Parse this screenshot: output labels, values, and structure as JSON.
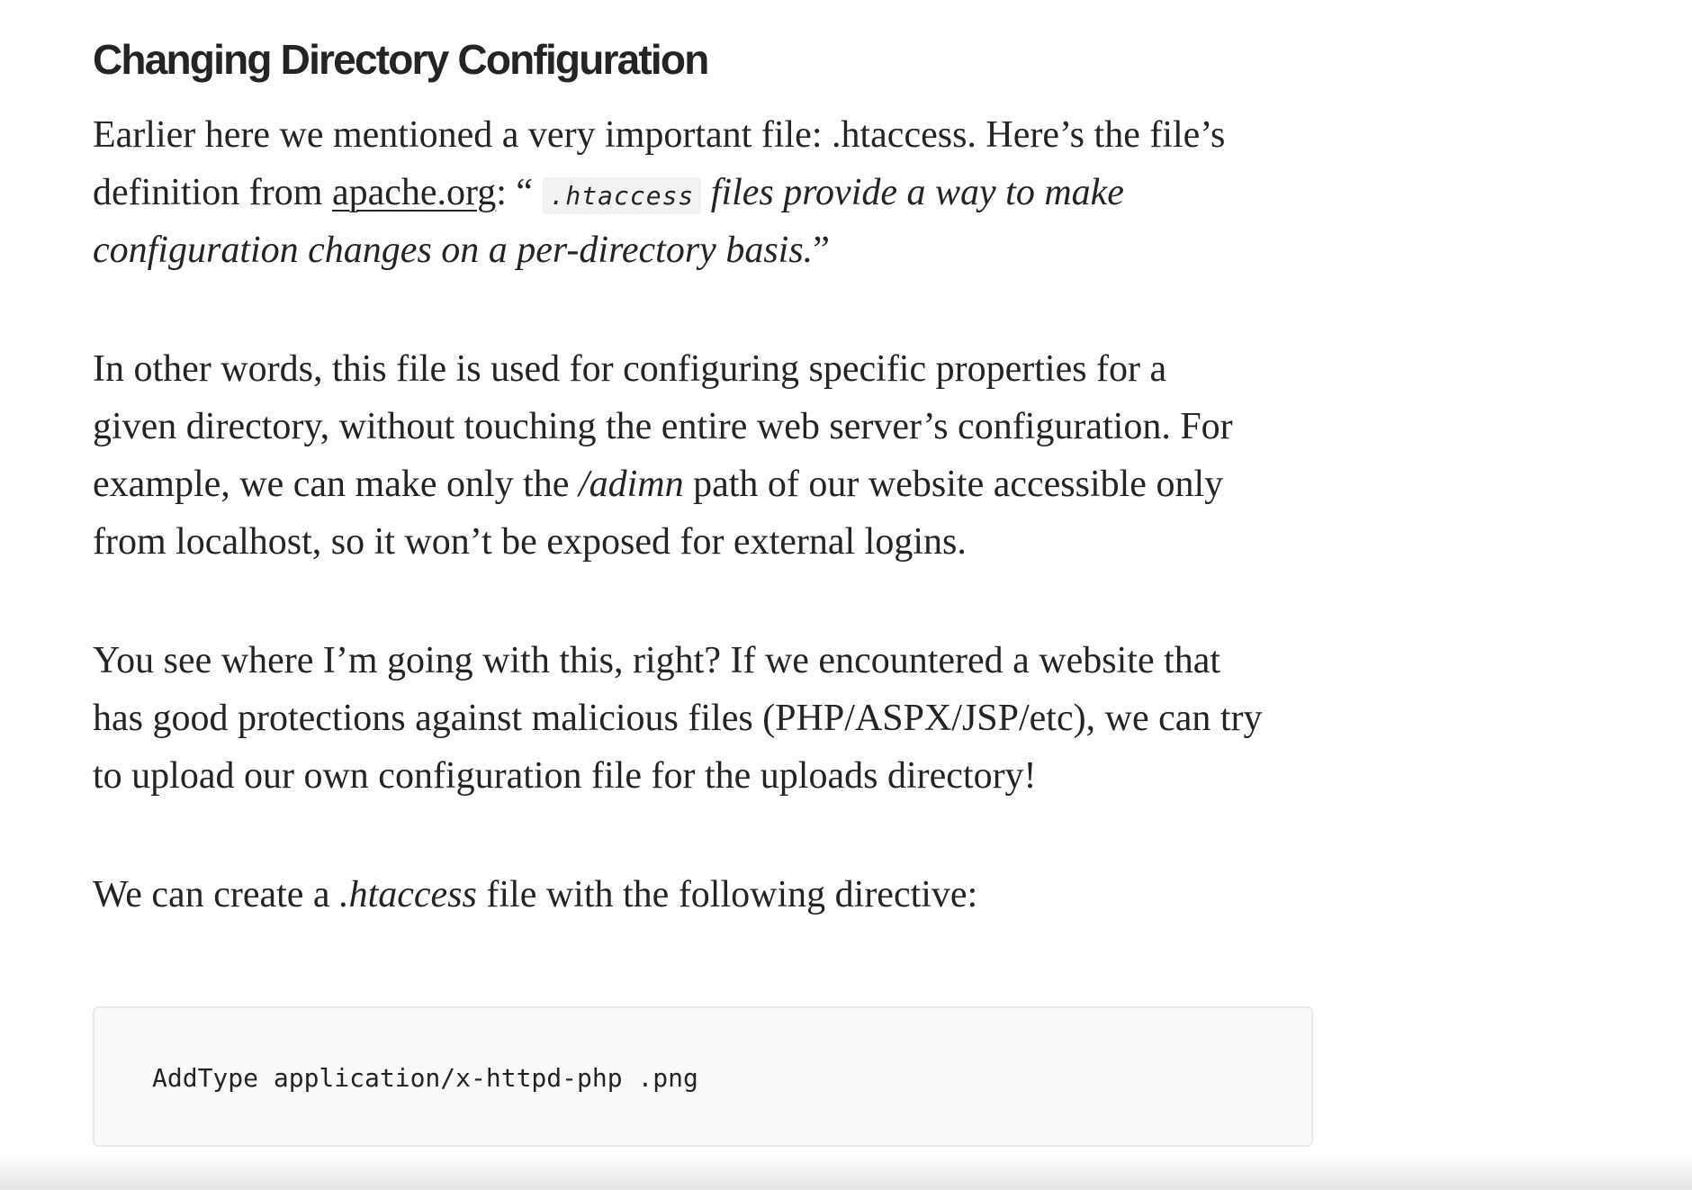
{
  "heading": "Changing Directory Configuration",
  "p1": {
    "l1": "Earlier here we mentioned a very important file: .htaccess. Here’s the file’s",
    "l2_pre": "definition from ",
    "l2_link": "apache.org",
    "l2_mid": ": “ ",
    "l2_code": ".htaccess",
    "l2_italic": " files provide a way to make",
    "l3_italic": "configuration changes on a per-directory basis.",
    "l3_post": "”"
  },
  "p2": {
    "l1": "In other words, this file is used for configuring specific properties for a",
    "l2": "given directory, without touching the entire web server’s configuration. For",
    "l3_pre": "example, we can make only the ",
    "l3_italic": "/adimn",
    "l3_post": " path of our website accessible only",
    "l4": "from localhost, so it won’t be exposed for external logins."
  },
  "p3": {
    "l1": "You see where I’m going with this, right? If we encountered a website that",
    "l2": "has good protections against malicious files (PHP/ASPX/JSP/etc), we can try",
    "l3": "to upload our own configuration file for the uploads directory!"
  },
  "p4": {
    "pre": "We can create a ",
    "italic": ".htaccess",
    "post": " file with the following directive:"
  },
  "code_block": "AddType application/x-httpd-php .png"
}
